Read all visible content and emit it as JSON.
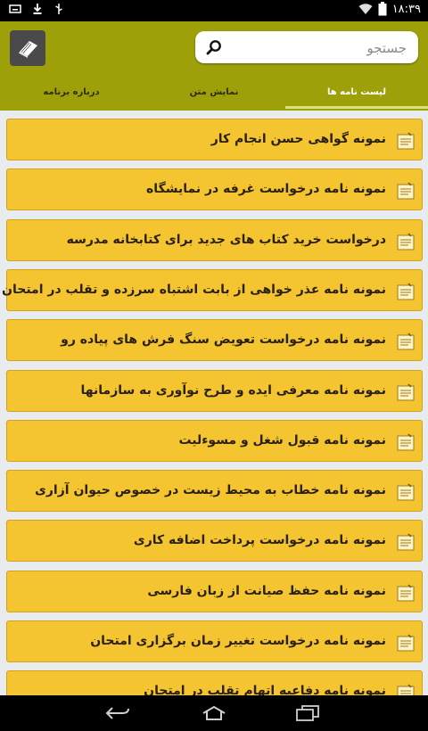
{
  "status_bar": {
    "time": "۱۸:۳۹"
  },
  "header": {
    "search": {
      "placeholder": "جستجو"
    },
    "tabs": [
      {
        "label": "لیست نامه ها",
        "active": true
      },
      {
        "label": "نمایش متن",
        "active": false
      },
      {
        "label": "درباره برنامه",
        "active": false
      }
    ]
  },
  "list": {
    "items": [
      {
        "label": "نمونه گواهی حسن انجام کار"
      },
      {
        "label": "نمونه نامه درخواست غرفه در نمایشگاه"
      },
      {
        "label": "درخواست خرید کتاب های جدید برای کتابخانه مدرسه"
      },
      {
        "label": "نمونه نامه عذر خواهی از بابت اشتباه سرزده و تقلب در امتحان"
      },
      {
        "label": "نمونه نامه درخواست تعویض سنگ فرش های پیاده رو"
      },
      {
        "label": "نمونه نامه معرفی ایده و طرح نوآوری به سازمانها"
      },
      {
        "label": "نمونه نامه قبول شغل و مسوءلیت"
      },
      {
        "label": "نمونه نامه خطاب به محیط زیست در خصوص حیوان آزاری"
      },
      {
        "label": "نمونه نامه درخواست پرداخت اضافه کاری"
      },
      {
        "label": "نمونه نامه حفظ صیانت از زبان فارسی"
      },
      {
        "label": "نمونه نامه درخواست تغییر زمان برگزاری امتحان"
      },
      {
        "label": "نمونه نامه دفاعیه اتهام تقلب در امتحان"
      }
    ]
  },
  "colors": {
    "header": "#9ea00a",
    "item_bg": "#f5c531",
    "item_border": "#d2a21b",
    "tab_indicator": "#d7e37a"
  }
}
